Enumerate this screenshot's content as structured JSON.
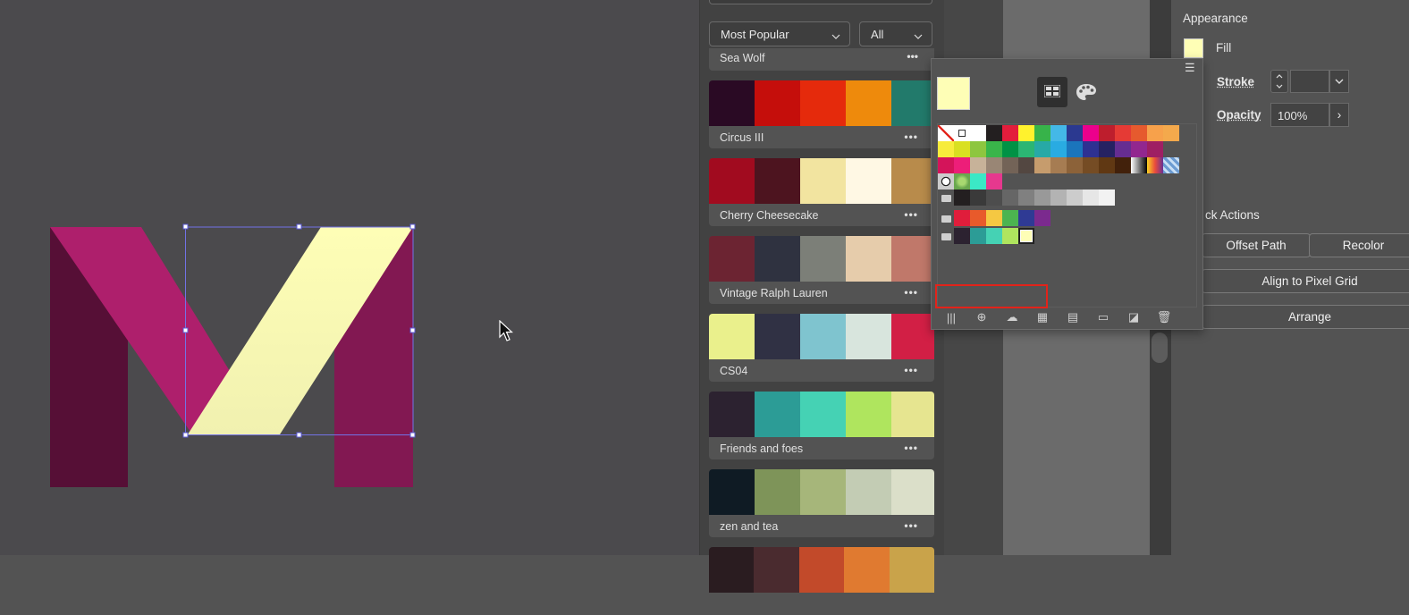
{
  "filters": {
    "sort": "Most Popular",
    "category": "All"
  },
  "themes": [
    {
      "name": "Sea Wolf",
      "colors": []
    },
    {
      "name": "Circus III",
      "colors": [
        "#2a0a24",
        "#c50e0b",
        "#e52a0c",
        "#ee8a0c",
        "#227a6b"
      ]
    },
    {
      "name": "Cherry Cheesecake",
      "colors": [
        "#a10b1f",
        "#4d141f",
        "#f2e4a0",
        "#fff8e4",
        "#b88b4b"
      ]
    },
    {
      "name": "Vintage Ralph Lauren",
      "colors": [
        "#6c2432",
        "#2f3240",
        "#7c7f78",
        "#e6ccab",
        "#c0786a"
      ]
    },
    {
      "name": "CS04",
      "colors": [
        "#eaf08c",
        "#303144",
        "#7fc4cf",
        "#d8e5dd",
        "#d21f45"
      ]
    },
    {
      "name": "Friends and foes",
      "colors": [
        "#2c2230",
        "#2c9c96",
        "#45d2b4",
        "#afe55e",
        "#e6e590"
      ]
    },
    {
      "name": "zen and tea",
      "colors": [
        "#0f1b24",
        "#7e9459",
        "#a6b67a",
        "#c3ccb4",
        "#dbdfc9"
      ]
    }
  ],
  "more_label": "•••",
  "properties": {
    "appearance_title": "Appearance",
    "fill_label": "Fill",
    "fill_color": "#fefeb6",
    "stroke_label": "Stroke",
    "opacity_label": "Opacity",
    "opacity_value": "100%",
    "quick_actions_title": "ck Actions",
    "offset_path": "Offset Path",
    "recolor": "Recolor",
    "align_pixel": "Align to Pixel Grid",
    "arrange": "Arrange"
  },
  "swatches": {
    "current": "#fefeb6",
    "rows": [
      [
        "none",
        "reg",
        "#ffffff",
        "#231f20",
        "#e31d3c",
        "#fff22d",
        "#37b34a",
        "#44b8e7",
        "#2b3990",
        "#ec008c",
        "#be1e2d",
        "#e53a35",
        "#e65a2e",
        "#f7a14b",
        "#f4a94c"
      ],
      [
        "#f7ec3b",
        "#d9e021",
        "#8dc63f",
        "#39b54a",
        "#009245",
        "#2bb673",
        "#27a9a6",
        "#29abe2",
        "#1b75bc",
        "#2e3192",
        "#262262",
        "#662d91",
        "#92278f",
        "#9e1f63"
      ],
      [
        "#d4145a",
        "#ed1e79",
        "#c7b299",
        "#998675",
        "#736357",
        "#534741",
        "#c69c6d",
        "#a67c52",
        "#8c6239",
        "#754c24",
        "#603813",
        "#42210b",
        "grad1",
        "grad2",
        "grad3"
      ],
      [
        "pat1",
        "pat2",
        "#3be8c6",
        "#e6388e"
      ],
      [
        "folder",
        "#231f20",
        "#3a3a3a",
        "#4d4d4d",
        "#666666",
        "#808080",
        "#999999",
        "#b3b3b3",
        "#cccccc",
        "#e6e6e6",
        "#f2f2f2"
      ],
      [
        "folder",
        "#e01d3b",
        "#e85a2b",
        "#f5c842",
        "#4cb450",
        "#2f3a94",
        "#7b2a8e"
      ],
      [
        "folder",
        "#2c2230",
        "#2c9c96",
        "#45d2b4",
        "#afe55e",
        "#fefeb6"
      ]
    ]
  }
}
